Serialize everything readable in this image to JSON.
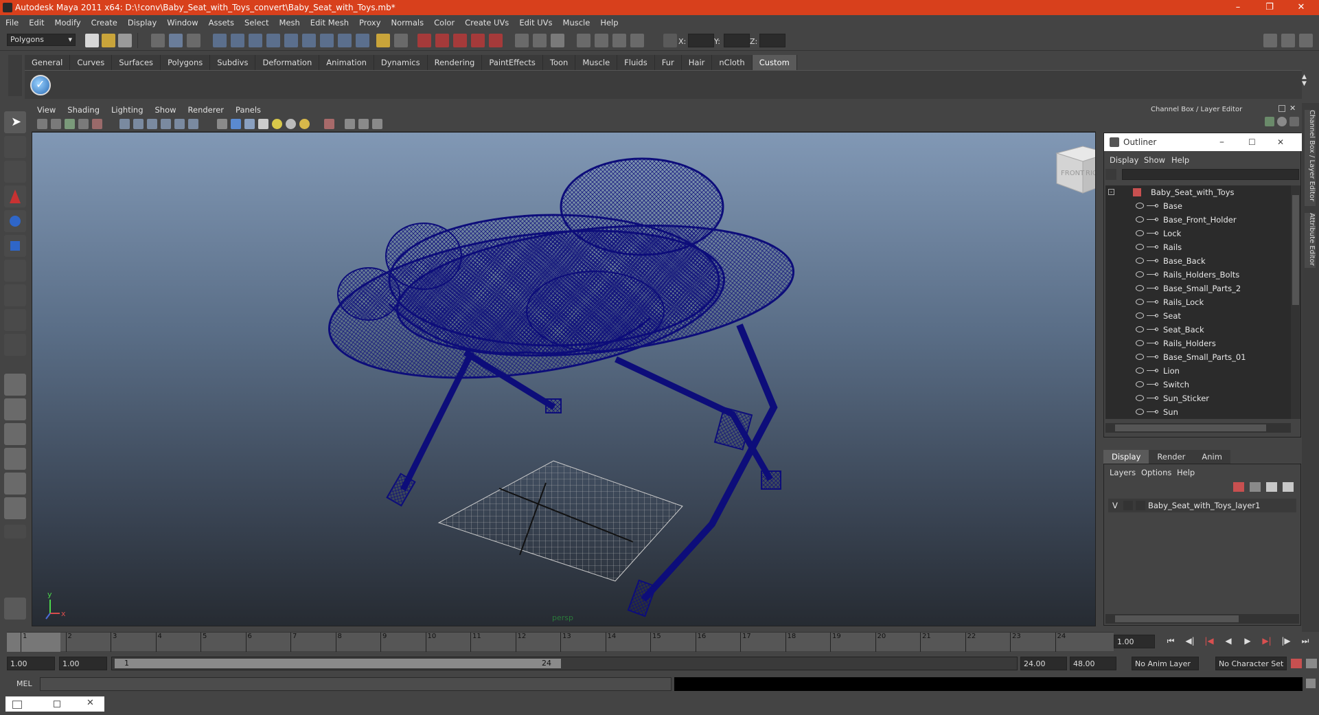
{
  "window": {
    "title": "Autodesk Maya 2011 x64: D:\\!conv\\Baby_Seat_with_Toys_convert\\Baby_Seat_with_Toys.mb*"
  },
  "menubar": [
    "File",
    "Edit",
    "Modify",
    "Create",
    "Display",
    "Window",
    "Assets",
    "Select",
    "Mesh",
    "Edit Mesh",
    "Proxy",
    "Normals",
    "Color",
    "Create UVs",
    "Edit UVs",
    "Muscle",
    "Help"
  ],
  "statusline": {
    "mode": "Polygons",
    "x_label": "X:",
    "y_label": "Y:",
    "z_label": "Z:"
  },
  "shelf": {
    "tabs": [
      "General",
      "Curves",
      "Surfaces",
      "Polygons",
      "Subdivs",
      "Deformation",
      "Animation",
      "Dynamics",
      "Rendering",
      "PaintEffects",
      "Toon",
      "Muscle",
      "Fluids",
      "Fur",
      "Hair",
      "nCloth",
      "Custom"
    ],
    "active": "Custom"
  },
  "viewport": {
    "menu": [
      "View",
      "Shading",
      "Lighting",
      "Show",
      "Renderer",
      "Panels"
    ],
    "camera_label": "persp",
    "viewcube_front": "FRONT",
    "viewcube_right": "RIGHT",
    "axis_x": "x",
    "axis_y": "y",
    "wire_color": "#0d0d7a"
  },
  "channel_box": {
    "title": "Channel Box / Layer Editor",
    "side_tabs": [
      "Channel Box / Layer Editor",
      "Attribute Editor"
    ]
  },
  "outliner": {
    "title": "Outliner",
    "menu": [
      "Display",
      "Show",
      "Help"
    ],
    "root": "Baby_Seat_with_Toys",
    "items": [
      "Base",
      "Base_Front_Holder",
      "Lock",
      "Rails",
      "Base_Back",
      "Rails_Holders_Bolts",
      "Base_Small_Parts_2",
      "Rails_Lock",
      "Seat",
      "Seat_Back",
      "Rails_Holders",
      "Base_Small_Parts_01",
      "Lion",
      "Switch",
      "Sun_Sticker",
      "Sun"
    ]
  },
  "layer_editor": {
    "tabs": [
      "Display",
      "Render",
      "Anim"
    ],
    "active": "Display",
    "menu": [
      "Layers",
      "Options",
      "Help"
    ],
    "layer_visible": "V",
    "layer_name": "Baby_Seat_with_Toys_layer1"
  },
  "timeline": {
    "ticks": [
      "1",
      "2",
      "3",
      "4",
      "5",
      "6",
      "7",
      "8",
      "9",
      "10",
      "11",
      "12",
      "13",
      "14",
      "15",
      "16",
      "17",
      "18",
      "19",
      "20",
      "21",
      "22",
      "23",
      "24"
    ],
    "current_frame_box": "1.00"
  },
  "range": {
    "start_time": "1.00",
    "start_range": "1.00",
    "slider_start": "1",
    "slider_end": "24",
    "end_range": "24.00",
    "end_time": "48.00",
    "anim_layer": "No Anim Layer",
    "character_set": "No Character Set"
  },
  "cmdline": {
    "label": "MEL"
  }
}
